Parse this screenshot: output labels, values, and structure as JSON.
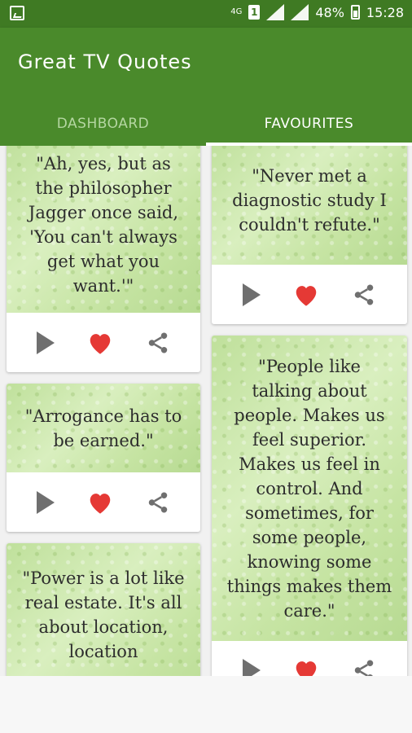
{
  "status": {
    "network": "4G",
    "sim": "1",
    "battery": "48%",
    "time": "15:28"
  },
  "app": {
    "title": "Great TV Quotes"
  },
  "tabs": [
    {
      "label": "DASHBOARD",
      "active": false
    },
    {
      "label": "FAVOURITES",
      "active": true
    }
  ],
  "cards": [
    {
      "quote": "\"Ah, yes, but as the philosopher Jagger once said, 'You can't always get what you want.'\""
    },
    {
      "quote": "\"Never met a diagnostic study I couldn't refute.\""
    },
    {
      "quote": "\"Arrogance has to be earned.\""
    },
    {
      "quote": "\"People like talking about people. Makes us feel superior. Makes us feel in control. And sometimes, for some people, knowing some things makes them care.\""
    },
    {
      "quote": "\"Power is a lot like real estate. It's all about location, location"
    }
  ],
  "colors": {
    "primary": "#4a8a2b",
    "status": "#3f7a23",
    "heart": "#e53935"
  }
}
